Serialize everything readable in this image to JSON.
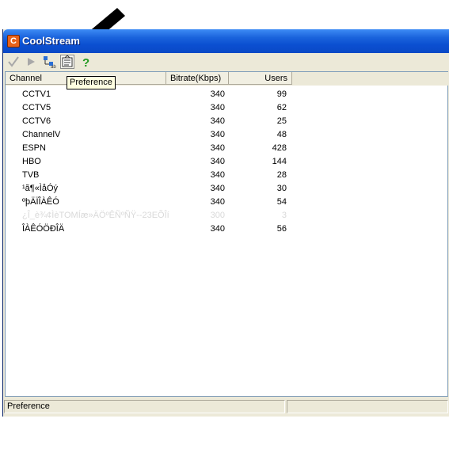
{
  "window": {
    "title": "CoolStream",
    "app_icon_letter": "C"
  },
  "toolbar": {
    "buttons": [
      {
        "icon": "checkmark-icon"
      },
      {
        "icon": "play-icon"
      },
      {
        "icon": "channel-tree-icon"
      },
      {
        "icon": "preference-icon"
      },
      {
        "icon": "help-icon"
      }
    ]
  },
  "tooltip": {
    "text": "Preference"
  },
  "columns": {
    "channel": "Channel",
    "bitrate": "Bitrate(Kbps)",
    "users": "Users"
  },
  "rows": [
    {
      "name": "CCTV1",
      "bitrate": "340",
      "users": "99",
      "dim": false
    },
    {
      "name": "CCTV5",
      "bitrate": "340",
      "users": "62",
      "dim": false
    },
    {
      "name": "CCTV6",
      "bitrate": "340",
      "users": "25",
      "dim": false
    },
    {
      "name": "ChannelV",
      "bitrate": "340",
      "users": "48",
      "dim": false
    },
    {
      "name": "ESPN",
      "bitrate": "340",
      "users": "428",
      "dim": false
    },
    {
      "name": "HBO",
      "bitrate": "340",
      "users": "144",
      "dim": false
    },
    {
      "name": "TVB",
      "bitrate": "340",
      "users": "28",
      "dim": false
    },
    {
      "name": "¹ã¶«ÌåÓý",
      "bitrate": "340",
      "users": "30",
      "dim": false
    },
    {
      "name": "ºþÄÏÎÀÊÓ",
      "bitrate": "340",
      "users": "54",
      "dim": false
    },
    {
      "name": "¿Î_è¾¢ÌèTOMÍæ»ÄÖºÊÑºÑŸ--23EÕÎí",
      "bitrate": "300",
      "users": "3",
      "dim": true
    },
    {
      "name": "ÎÀÊÓÖÐÎÄ",
      "bitrate": "340",
      "users": "56",
      "dim": false
    }
  ],
  "statusbar": {
    "text": "Preference",
    "second_pane": ""
  }
}
